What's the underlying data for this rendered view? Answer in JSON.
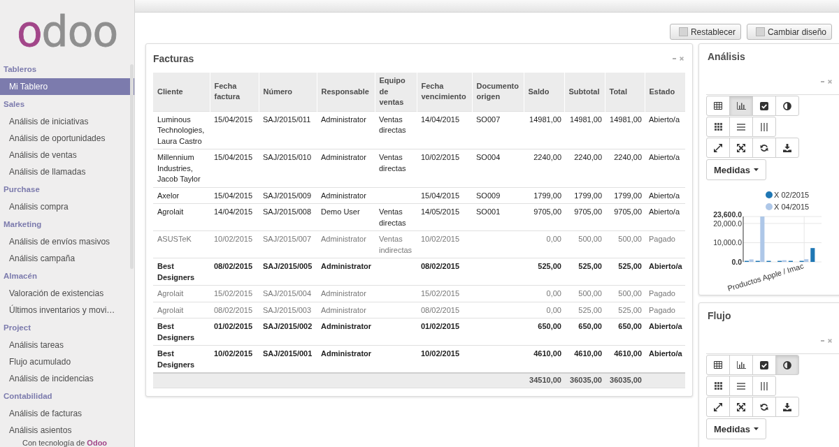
{
  "sidebar": {
    "logo": "odoo",
    "sections": [
      {
        "title": "Tableros",
        "items": [
          {
            "label": "Mi Tablero",
            "selected": true
          }
        ]
      },
      {
        "title": "Sales",
        "items": [
          {
            "label": "Análisis de iniciativas",
            "selected": false
          },
          {
            "label": "Análisis de oportunidades",
            "selected": false
          },
          {
            "label": "Análisis de ventas",
            "selected": false
          },
          {
            "label": "Análisis de llamadas",
            "selected": false
          }
        ]
      },
      {
        "title": "Purchase",
        "items": [
          {
            "label": "Análisis compra",
            "selected": false
          }
        ]
      },
      {
        "title": "Marketing",
        "items": [
          {
            "label": "Análisis de envíos masivos",
            "selected": false
          },
          {
            "label": "Análisis campaña",
            "selected": false
          }
        ]
      },
      {
        "title": "Almacén",
        "items": [
          {
            "label": "Valoración de existencias",
            "selected": false
          },
          {
            "label": "Últimos inventarios y movi…",
            "selected": false
          }
        ]
      },
      {
        "title": "Project",
        "items": [
          {
            "label": "Análisis tareas",
            "selected": false
          },
          {
            "label": "Flujo acumulado",
            "selected": false
          },
          {
            "label": "Análisis de incidencias",
            "selected": false
          }
        ]
      },
      {
        "title": "Contabilidad",
        "items": [
          {
            "label": "Análisis de facturas",
            "selected": false
          },
          {
            "label": "Análisis asientos",
            "selected": false
          }
        ]
      }
    ],
    "footer": "Con tecnología de **Odoo**"
  },
  "toolbar_buttons": [
    "Restablecer",
    "Cambiar diseño"
  ],
  "invoices": {
    "title": "Facturas",
    "columns": [
      "Cliente",
      "Fecha factura",
      "Número",
      "Responsable",
      "Equipo de ventas",
      "Fecha vencimiento",
      "Documento origen",
      "Saldo",
      "Subtotal",
      "Total",
      "Estado"
    ],
    "rows": [
      {
        "kind": "normal",
        "client": "Luminous Technologies, Laura Castro",
        "invoice_date": "15/04/2015",
        "number": "SAJ/2015/011",
        "responsible": "Administrator",
        "sales_team": "Ventas directas",
        "due_date": "14/04/2015",
        "source_document": "SO007",
        "balance": "14981,00",
        "subtotal": "14981,00",
        "total": "14981,00",
        "status": "Abierto/a"
      },
      {
        "kind": "normal",
        "client": "Millennium Industries, Jacob Taylor",
        "invoice_date": "15/04/2015",
        "number": "SAJ/2015/010",
        "responsible": "Administrator",
        "sales_team": "Ventas directas",
        "due_date": "10/02/2015",
        "source_document": "SO004",
        "balance": "2240,00",
        "subtotal": "2240,00",
        "total": "2240,00",
        "status": "Abierto/a"
      },
      {
        "kind": "normal",
        "client": "Axelor",
        "invoice_date": "15/04/2015",
        "number": "SAJ/2015/009",
        "responsible": "Administrator",
        "due_date": "15/04/2015",
        "source_document": "SO009",
        "balance": "1799,00",
        "subtotal": "1799,00",
        "total": "1799,00",
        "status": "Abierto/a"
      },
      {
        "kind": "normal",
        "client": "Agrolait",
        "invoice_date": "14/04/2015",
        "number": "SAJ/2015/008",
        "responsible": "Demo User",
        "sales_team": "Ventas directas",
        "due_date": "14/05/2015",
        "source_document": "SO001",
        "balance": "9705,00",
        "subtotal": "9705,00",
        "total": "9705,00",
        "status": "Abierto/a"
      },
      {
        "kind": "muted",
        "client": "ASUSTeK",
        "invoice_date": "10/02/2015",
        "number": "SAJ/2015/007",
        "responsible": "Administrator",
        "sales_team": "Ventas indirectas",
        "due_date": "10/02/2015",
        "balance": "0,00",
        "subtotal": "500,00",
        "total": "500,00",
        "status": "Pagado"
      },
      {
        "kind": "bold",
        "client": "Best Designers",
        "invoice_date": "08/02/2015",
        "number": "SAJ/2015/005",
        "responsible": "Administrator",
        "due_date": "08/02/2015",
        "balance": "525,00",
        "subtotal": "525,00",
        "total": "525,00",
        "status": "Abierto/a"
      },
      {
        "kind": "muted",
        "client": "Agrolait",
        "invoice_date": "15/02/2015",
        "number": "SAJ/2015/004",
        "responsible": "Administrator",
        "due_date": "15/02/2015",
        "balance": "0,00",
        "subtotal": "500,00",
        "total": "500,00",
        "status": "Pagado"
      },
      {
        "kind": "muted",
        "client": "Agrolait",
        "invoice_date": "08/02/2015",
        "number": "SAJ/2015/003",
        "responsible": "Administrator",
        "due_date": "08/02/2015",
        "balance": "0,00",
        "subtotal": "525,00",
        "total": "525,00",
        "status": "Pagado"
      },
      {
        "kind": "bold",
        "client": "Best Designers",
        "invoice_date": "01/02/2015",
        "number": "SAJ/2015/002",
        "responsible": "Administrator",
        "due_date": "01/02/2015",
        "balance": "650,00",
        "subtotal": "650,00",
        "total": "650,00",
        "status": "Abierto/a"
      },
      {
        "kind": "bold",
        "client": "Best Designers",
        "invoice_date": "10/02/2015",
        "number": "SAJ/2015/001",
        "responsible": "Administrator",
        "due_date": "10/02/2015",
        "balance": "4610,00",
        "subtotal": "4610,00",
        "total": "4610,00",
        "status": "Abierto/a"
      }
    ],
    "totals": {
      "balance": "34510,00",
      "subtotal": "36035,00",
      "total": "36035,00"
    }
  },
  "panels": [
    {
      "title": "Análisis",
      "view_buttons": [
        {
          "selected": false
        },
        {
          "selected": true
        },
        {
          "selected": false
        },
        {
          "selected": false
        }
      ],
      "measures_button": "Medidas",
      "chart_data": {
        "type": "bar",
        "categories": [
          null,
          null,
          null,
          null,
          null,
          "Productos Apple / Imac",
          null
        ],
        "series": [
          {
            "name": "X 02/2015",
            "color": "#1f77b4",
            "values": [
              300,
              300,
              300,
              300,
              300,
              300,
              7200
            ]
          },
          {
            "name": "X 04/2015",
            "color": "#aec7e8",
            "values": [
              1300,
              23600,
              0,
              900,
              0,
              1400,
              0
            ]
          }
        ],
        "ylim": [
          0,
          23600
        ],
        "yticks": [
          {
            "value": 0,
            "label": "0.0"
          },
          {
            "value": 10000,
            "label": "10,000.0"
          },
          {
            "value": 20000,
            "label": "20,000.0"
          },
          {
            "value": 23600,
            "label": "23,600.0"
          }
        ],
        "grid": true,
        "legend": "top"
      }
    },
    {
      "title": "Flujo",
      "view_buttons": [
        {
          "selected": false
        },
        {
          "selected": false
        },
        {
          "selected": false
        },
        {
          "selected": true
        }
      ],
      "measures_button": "Medidas"
    }
  ]
}
